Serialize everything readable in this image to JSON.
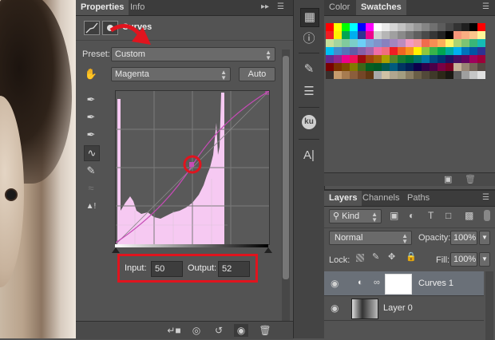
{
  "properties_panel": {
    "tabs": [
      "Properties",
      "Info"
    ],
    "adjustment_title": "Curves",
    "preset_label": "Preset:",
    "preset_value": "Custom",
    "channel_value": "Magenta",
    "auto_label": "Auto",
    "input_label": "Input:",
    "input_value": "50",
    "output_label": "Output:",
    "output_value": "52"
  },
  "swatches_panel": {
    "tabs": [
      "Color",
      "Swatches"
    ],
    "rows": [
      [
        "#ff0000",
        "#ffff00",
        "#00ff00",
        "#00ffff",
        "#0000ff",
        "#ff00ff",
        "#ffffff",
        "#ebebeb",
        "#d6d6d6",
        "#c2c2c2",
        "#adadad",
        "#999999",
        "#858585",
        "#707070",
        "#5c5c5c",
        "#474747",
        "#333333",
        "#1f1f1f",
        "#000000",
        "#ff0000"
      ],
      [
        "#ee1d24",
        "#fff100",
        "#00a650",
        "#00aeef",
        "#2f3192",
        "#ed008c",
        "#cfcfcf",
        "#b6b6b6",
        "#a0a0a0",
        "#8a8a8a",
        "#747474",
        "#5f5f5f",
        "#4a4a4a",
        "#363636",
        "#222222",
        "#000000",
        "#f7977a",
        "#fbad82",
        "#fdc68c",
        "#fff799"
      ],
      [
        "#c6df9c",
        "#a4d49d",
        "#81ca9d",
        "#7bcdc9",
        "#6ccff7",
        "#7ca6d8",
        "#8293ca",
        "#8881be",
        "#a286bd",
        "#bc8cbf",
        "#f49bc1",
        "#f5999d",
        "#f16c4d",
        "#f68e54",
        "#fbaf5a",
        "#fff467",
        "#acd372",
        "#7dc473",
        "#39b778",
        "#16bcb4"
      ],
      [
        "#00bff3",
        "#438ccb",
        "#5573b7",
        "#5e5ca7",
        "#855fa8",
        "#a763a9",
        "#ef6ea8",
        "#f16d7e",
        "#ee1d24",
        "#f16522",
        "#f7941d",
        "#fff100",
        "#8fc63d",
        "#37b44a",
        "#00a650",
        "#00a99e",
        "#00aeef",
        "#0072bc",
        "#0054a5",
        "#2f3192"
      ],
      [
        "#652c91",
        "#91278f",
        "#ed008c",
        "#ee105a",
        "#9d0a0f",
        "#a1410d",
        "#a36209",
        "#aba000",
        "#588528",
        "#197b30",
        "#007236",
        "#00736a",
        "#0076a4",
        "#004a80",
        "#003370",
        "#1d1363",
        "#450e61",
        "#62055f",
        "#9e005c",
        "#9d0039"
      ],
      [
        "#790000",
        "#7b3000",
        "#7c4900",
        "#827a00",
        "#3e6617",
        "#045f20",
        "#005824",
        "#005951",
        "#005b7e",
        "#003562",
        "#002056",
        "#0c004b",
        "#30004a",
        "#4b0048",
        "#7a0045",
        "#7a0026",
        "#c7b299",
        "#998675",
        "#736357",
        "#534741"
      ],
      [
        "#37302d",
        "#c69c6d",
        "#a77c50",
        "#8b5e3c",
        "#744627",
        "#603813",
        "#aaaaaa",
        "#cfc1a4",
        "#b0a68f",
        "#a39d80",
        "#8a7e63",
        "#6a5f47",
        "#524939",
        "#3f3929",
        "#2c2818",
        "#1a1812",
        "#5e5e5e",
        "#9f9f9f",
        "#c6c6c6",
        "#e1e1e1"
      ]
    ]
  },
  "layers_panel": {
    "tabs": [
      "Layers",
      "Channels",
      "Paths"
    ],
    "kind_label": "Kind",
    "blend_mode": "Normal",
    "opacity_label": "Opacity:",
    "opacity_value": "100%",
    "lock_label": "Lock:",
    "fill_label": "Fill:",
    "fill_value": "100%",
    "layers": [
      {
        "name": "Curves 1"
      },
      {
        "name": "Layer 0"
      }
    ]
  }
}
